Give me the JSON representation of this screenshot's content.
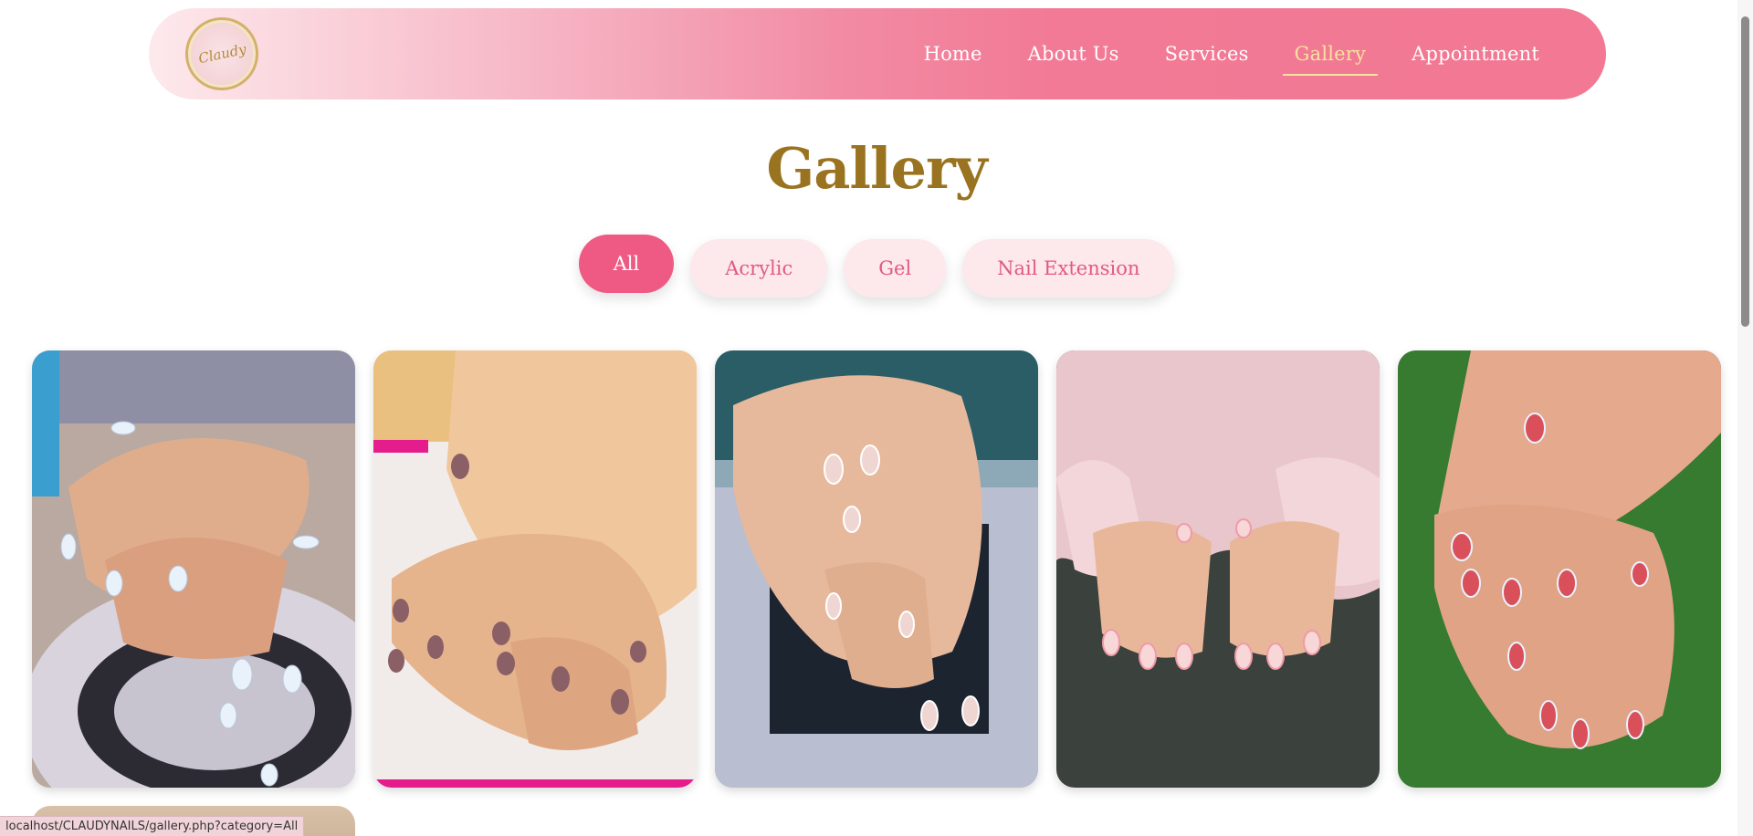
{
  "nav": {
    "logo_text": "Claudy",
    "links": [
      {
        "label": "Home",
        "active": false
      },
      {
        "label": "About Us",
        "active": false
      },
      {
        "label": "Services",
        "active": false
      },
      {
        "label": "Gallery",
        "active": true
      },
      {
        "label": "Appointment",
        "active": false
      }
    ]
  },
  "page": {
    "title": "Gallery"
  },
  "filters": [
    {
      "label": "All",
      "active": true
    },
    {
      "label": "Acrylic",
      "active": false
    },
    {
      "label": "Gel",
      "active": false
    },
    {
      "label": "Nail Extension",
      "active": false
    }
  ],
  "gallery": {
    "items": [
      {
        "alt": "white-pearl-nails-photo"
      },
      {
        "alt": "mauve-glitter-nails-photo"
      },
      {
        "alt": "french-tip-nails-photo"
      },
      {
        "alt": "pink-blush-nails-photo"
      },
      {
        "alt": "red-bow-nails-photo"
      }
    ]
  },
  "status": {
    "url": "localhost/CLAUDYNAILS/gallery.php?category=All"
  },
  "colors": {
    "accent": "#ee5a83",
    "title_gold": "#9a7320",
    "nav_pink": "#f27893",
    "active_link": "#f7e3a0"
  }
}
